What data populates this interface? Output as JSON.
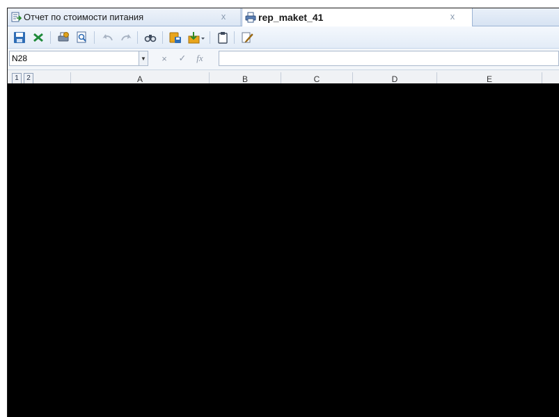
{
  "tabs": [
    {
      "label": "Отчет по стоимости питания",
      "icon": "report-export-icon",
      "close": "x"
    },
    {
      "label": "rep_maket_41",
      "icon": "printer-icon",
      "close": "x",
      "active": true
    }
  ],
  "toolbar": {
    "buttons": [
      "save-icon",
      "excel-icon",
      "print-settings-icon",
      "print-preview-icon",
      "undo-icon",
      "redo-icon",
      "find-icon",
      "save-as-icon",
      "load-dropdown-icon",
      "paste-icon",
      "edit-icon"
    ]
  },
  "formula_bar": {
    "name_box": "N28",
    "cancel_symbol": "×",
    "confirm_symbol": "✓",
    "function_symbol": "fx",
    "formula_value": ""
  },
  "sheet": {
    "outline_levels": [
      "1",
      "2"
    ],
    "columns": [
      "A",
      "B",
      "C",
      "D",
      "E"
    ]
  },
  "colors": {
    "tab_strip": "#dbe6f4",
    "border": "#9bb3d4",
    "redacted": "#000000"
  }
}
